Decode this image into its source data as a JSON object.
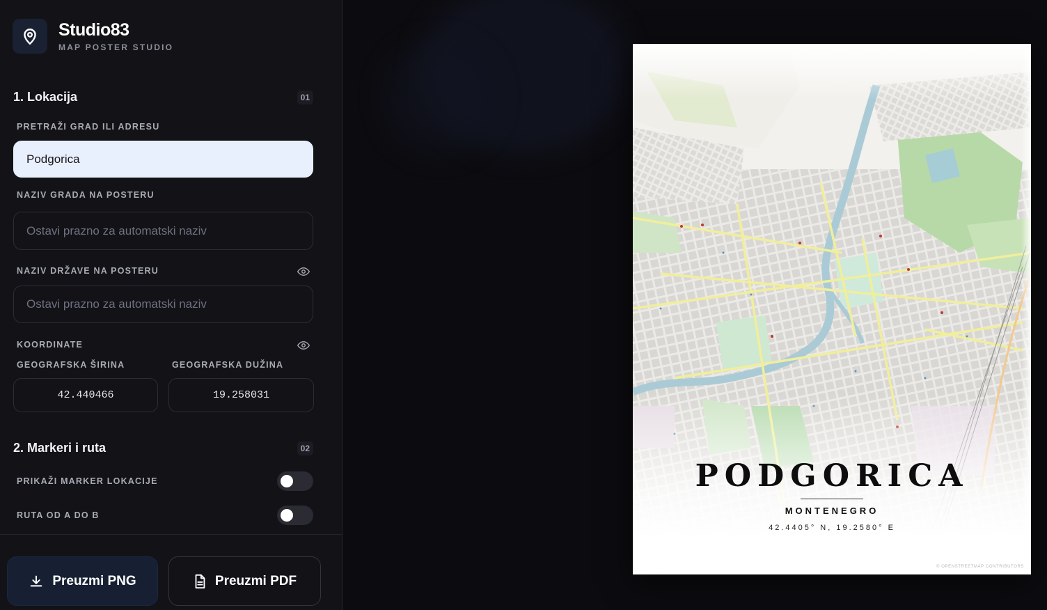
{
  "brand": {
    "title": "Studio83",
    "subtitle": "MAP POSTER STUDIO",
    "icon": "map-pin-icon"
  },
  "section1": {
    "title": "1. Lokacija",
    "number": "01",
    "search_label": "PRETRAŽI GRAD ILI ADRESU",
    "search_value": "Podgorica",
    "city_label": "NAZIV GRADA NA POSTERU",
    "city_placeholder": "Ostavi prazno za automatski naziv",
    "country_label": "NAZIV DRŽAVE NA POSTERU",
    "country_placeholder": "Ostavi prazno za automatski naziv",
    "coords_label": "KOORDINATE",
    "lat_label": "GEOGRAFSKA ŠIRINA",
    "lat_value": "42.440466",
    "lon_label": "GEOGRAFSKA DUŽINA",
    "lon_value": "19.258031"
  },
  "section2": {
    "title": "2. Markeri i ruta",
    "number": "02",
    "marker_label": "PRIKAŽI MARKER LOKACIJE",
    "marker_on": false,
    "route_label": "RUTA OD A DO B",
    "route_on": false
  },
  "footer": {
    "png_label": "Preuzmi PNG",
    "pdf_label": "Preuzmi PDF"
  },
  "poster": {
    "city": "PODGORICA",
    "country": "MONTENEGRO",
    "coords": "42.4405° N, 19.2580° E",
    "credit": "© OPENSTREETMAP CONTRIBUTORS"
  },
  "colors": {
    "accent": "#172033",
    "input_active": "#e9f0fd",
    "river": "#aacbd6",
    "park": "#c8e6c2",
    "road_major": "#f2f0a8"
  }
}
